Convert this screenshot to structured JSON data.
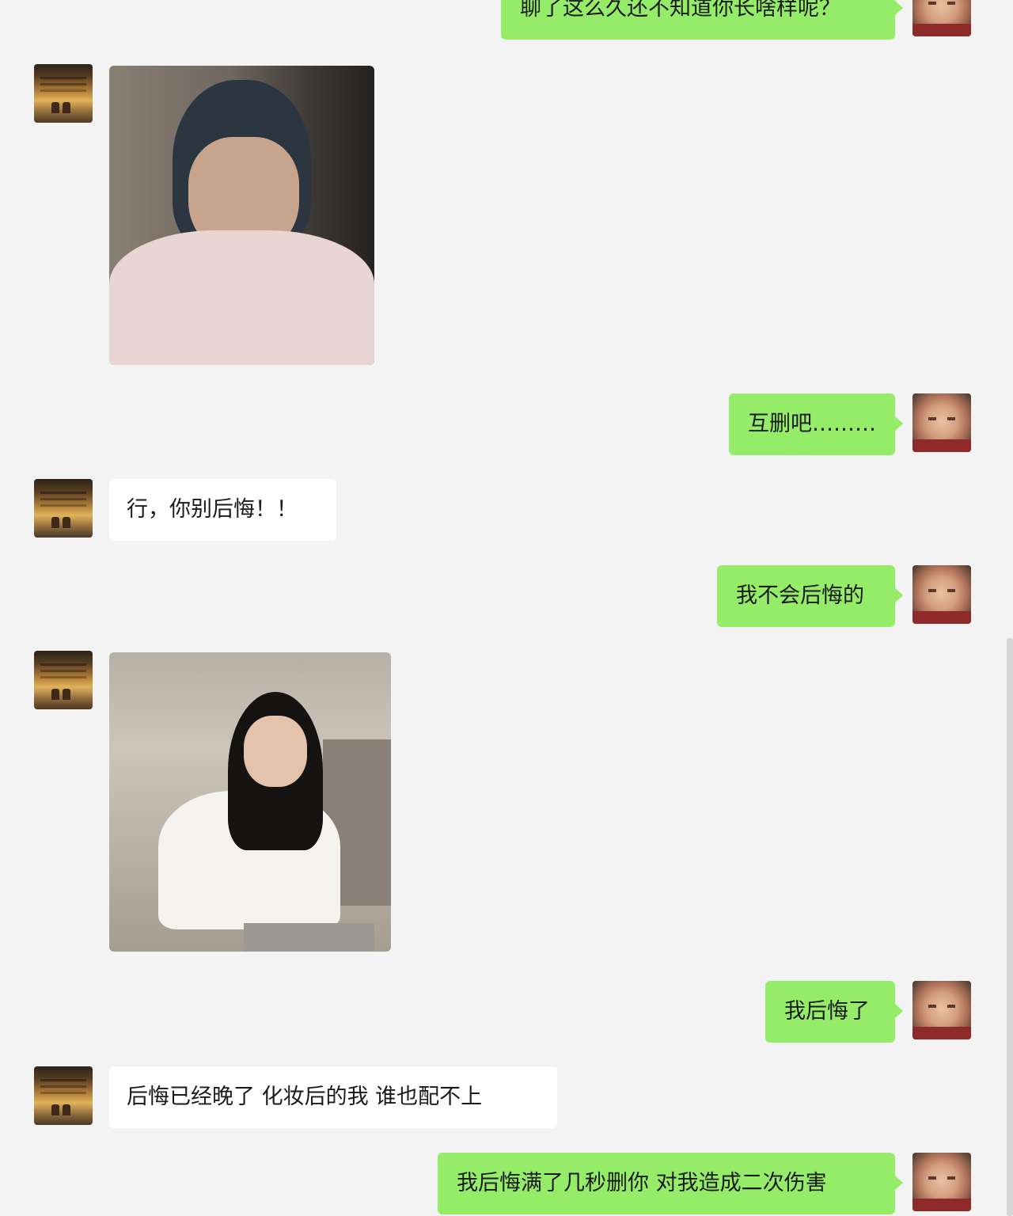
{
  "messages": [
    {
      "side": "out",
      "type": "text",
      "text": "聊了这么久还不知道你长啥样呢？"
    },
    {
      "side": "in",
      "type": "image",
      "description": "selfie photo"
    },
    {
      "side": "out",
      "type": "text",
      "text": "互删吧………"
    },
    {
      "side": "in",
      "type": "text",
      "text": "行，你别后悔！！"
    },
    {
      "side": "out",
      "type": "text",
      "text": "我不会后悔的"
    },
    {
      "side": "in",
      "type": "image",
      "description": "full photo"
    },
    {
      "side": "out",
      "type": "text",
      "text": "我后悔了"
    },
    {
      "side": "in",
      "type": "text",
      "text": "后悔已经晚了  化妆后的我  谁也配不上"
    },
    {
      "side": "out",
      "type": "text",
      "text": "我后悔满了几秒删你  对我造成二次伤害"
    }
  ],
  "colors": {
    "background": "#f3f3f3",
    "outgoing_bubble": "#95ec69",
    "incoming_bubble": "#ffffff"
  }
}
